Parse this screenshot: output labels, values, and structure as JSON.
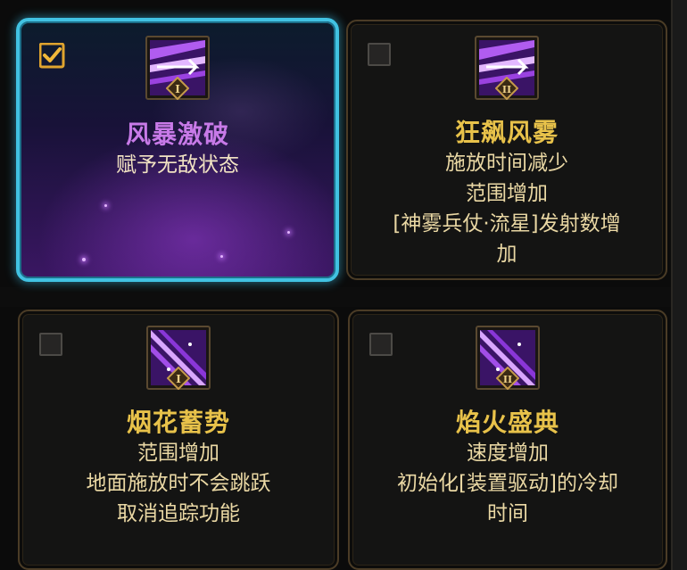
{
  "cards": [
    {
      "name": "风暴激破",
      "tier": "I",
      "checked": true,
      "selected": true,
      "name_color": "#c87ae8",
      "desc": [
        "赋予无敌状态"
      ]
    },
    {
      "name": "狂飙风雾",
      "tier": "II",
      "checked": false,
      "selected": false,
      "name_color": "#e8c24a",
      "desc": [
        "施放时间减少",
        "范围增加",
        "[神雾兵仗·流星]发射数增",
        "加"
      ]
    },
    {
      "name": "烟花蓄势",
      "tier": "I",
      "checked": false,
      "selected": false,
      "name_color": "#e8c24a",
      "desc": [
        "范围增加",
        "地面施放时不会跳跃",
        "取消追踪功能"
      ]
    },
    {
      "name": "焰火盛典",
      "tier": "II",
      "checked": false,
      "selected": false,
      "name_color": "#e8c24a",
      "desc": [
        "速度增加",
        "初始化[装置驱动]的冷却",
        "时间"
      ]
    }
  ],
  "icons": {
    "skill_art": "purple-wind-slash-icon",
    "checkbox_mark": "checkmark-icon",
    "tier_badge": "roman-numeral-diamond-icon"
  }
}
